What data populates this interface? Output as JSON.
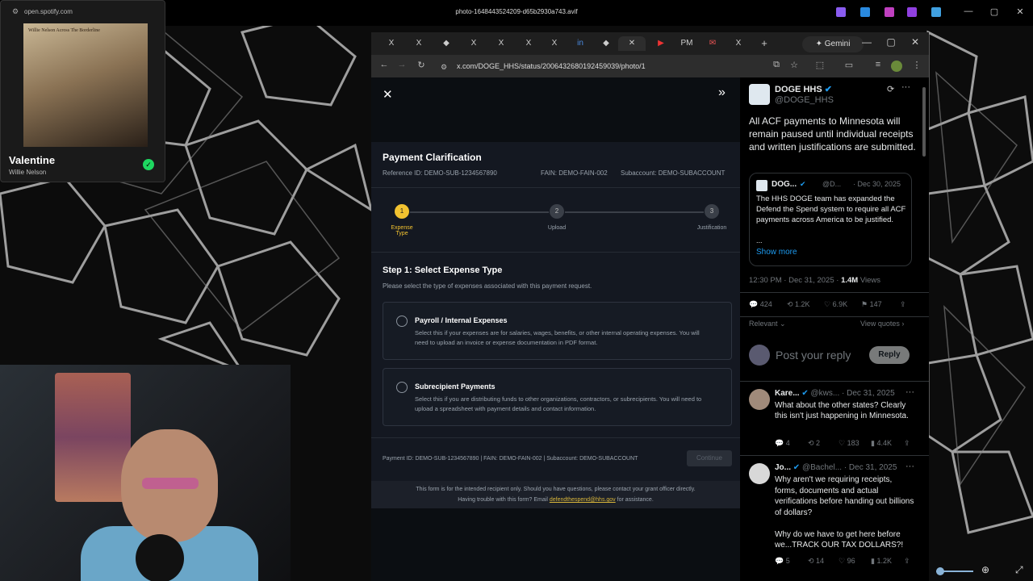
{
  "host": {
    "title": "photo-1648443524209-d65b2930a743.avif",
    "controls": {
      "minimize": "—",
      "maximize": "▢",
      "close": "✕"
    }
  },
  "spotify": {
    "url": "open.spotify.com",
    "album_text": "Willie Nelson   Across The Borderline",
    "song": "Valentine",
    "artist": "Willie Nelson"
  },
  "browser": {
    "tab_icons": [
      "X",
      "X",
      "◆",
      "X",
      "X",
      "X",
      "X",
      "in",
      "◆",
      "▶",
      "PM",
      "✉",
      "X"
    ],
    "new_tab": "+",
    "gemini_label": "Gemini",
    "url": "x.com/DOGE_HHS/status/2006432680192459039/photo/1",
    "nav": {
      "back": "←",
      "forward": "→",
      "reload": "↻"
    }
  },
  "form": {
    "title": "Payment Clarification",
    "reference": "Reference ID: DEMO-SUB-1234567890",
    "fain": "FAIN: DEMO-FAIN-002",
    "subaccount": "Subaccount: DEMO-SUBACCOUNT",
    "steps": [
      {
        "num": "1",
        "label": "Expense\nType"
      },
      {
        "num": "2",
        "label": "Upload"
      },
      {
        "num": "3",
        "label": "Justification"
      }
    ],
    "step_heading": "Step 1: Select Expense Type",
    "step_desc": "Please select the type of expenses associated with this payment request.",
    "options": [
      {
        "title": "Payroll / Internal Expenses",
        "desc": "Select this if your expenses are for salaries, wages, benefits, or other internal operating expenses. You will need to upload an invoice or expense documentation in PDF format."
      },
      {
        "title": "Subrecipient Payments",
        "desc": "Select this if you are distributing funds to other organizations, contractors, or subrecipients. You will need to upload a spreadsheet with payment details and contact information."
      }
    ],
    "footer": "Payment ID: DEMO-SUB-1234567890 | FAIN: DEMO-FAIN-002 | Subaccount: DEMO-SUBACCOUNT",
    "continue": "Continue",
    "notice1": "This form is for the intended recipient only. Should you have questions, please contact your grant officer directly.",
    "notice2_pre": "Having trouble with this form? Email ",
    "notice2_link": "defendthespend@hhs.gov",
    "notice2_post": " for assistance."
  },
  "post": {
    "name": "DOGE HHS",
    "handle": "@DOGE_HHS",
    "text": "All ACF payments to Minnesota will remain paused until individual receipts and written justifications are submitted.",
    "quote": {
      "name": "DOG...",
      "handle": "@D...",
      "date": "· Dec 30, 2025",
      "text": "The HHS DOGE team has expanded the Defend the Spend system to require all ACF payments across America to be justified.",
      "ellipsis": "...",
      "show_more": "Show more"
    },
    "time": "12:30 PM · Dec 31, 2025 · ",
    "views_count": "1.4M",
    "views_label": " Views",
    "stats": {
      "replies": "424",
      "reposts": "1.2K",
      "likes": "6.9K",
      "bookmarks": "147"
    },
    "relevant": "Relevant",
    "view_quotes": "View quotes",
    "reply_placeholder": "Post your reply",
    "reply_button": "Reply"
  },
  "replies": [
    {
      "name": "Kare...",
      "handle": "@kws...",
      "date": "· Dec 31, 2025",
      "text": "What about the other states? Clearly this isn't just happening in Minnesota.",
      "stats": {
        "r": "4",
        "rt": "2",
        "l": "183",
        "v": "4.4K"
      }
    },
    {
      "name": "Jo...",
      "handle": "@Bachel...",
      "date": "· Dec 31, 2025",
      "text": "Why aren't we requiring receipts, forms, documents and actual verifications before handing out billions of dollars?\n\nWhy do we have to get here before we...TRACK OUR TAX DOLLARS?!",
      "stats": {
        "r": "5",
        "rt": "14",
        "l": "96",
        "v": "1.2K"
      }
    }
  ],
  "colors": {
    "accent": "#1d9bf0",
    "step_active": "#f2c230",
    "spotify_green": "#1ed760"
  }
}
